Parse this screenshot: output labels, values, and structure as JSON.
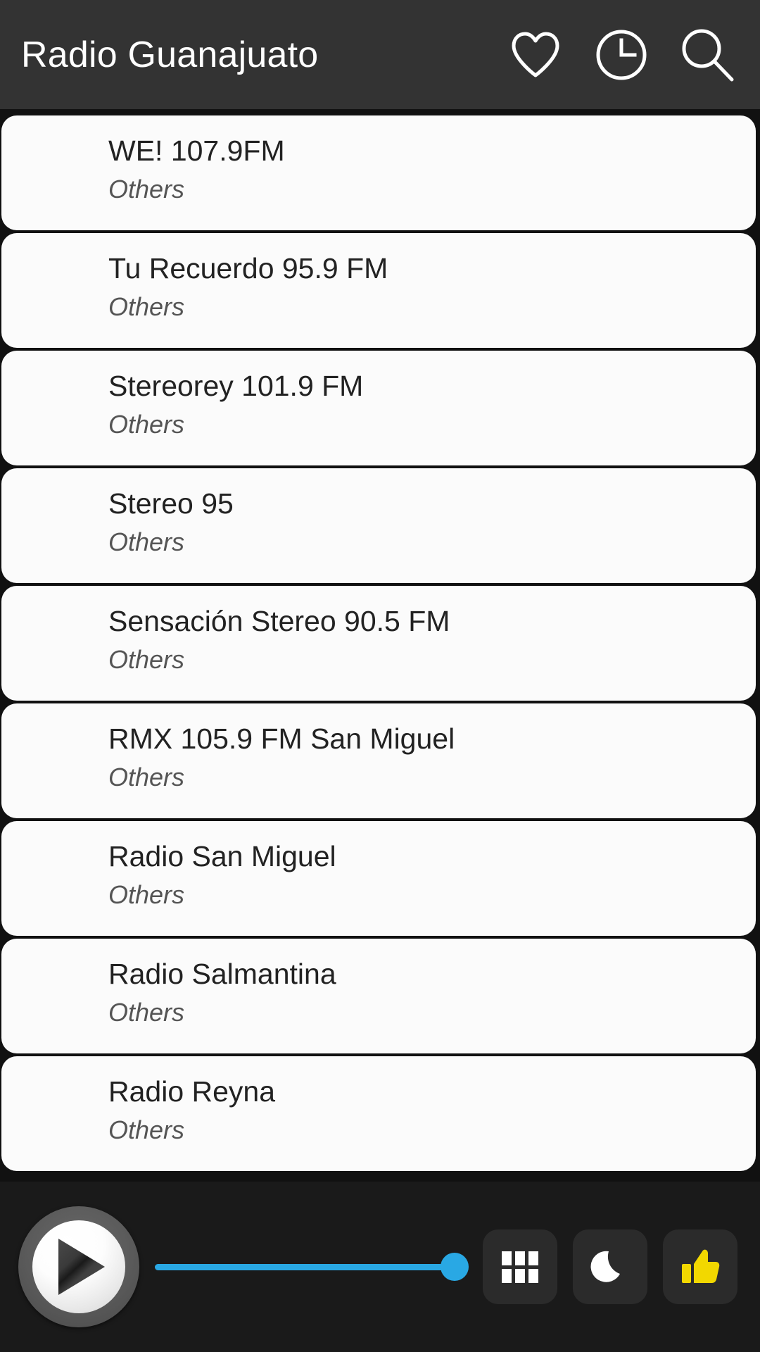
{
  "header": {
    "title": "Radio Guanajuato",
    "background_color": "#333333",
    "actions": [
      {
        "name": "favorites-icon",
        "icon": "heart-icon"
      },
      {
        "name": "history-icon",
        "icon": "clock-icon"
      },
      {
        "name": "search-icon",
        "icon": "search-icon"
      }
    ]
  },
  "stations": [
    {
      "name": "WE! 107.9FM",
      "genre": "Others"
    },
    {
      "name": "Tu Recuerdo 95.9 FM",
      "genre": "Others"
    },
    {
      "name": "Stereorey 101.9 FM",
      "genre": "Others"
    },
    {
      "name": "Stereo 95",
      "genre": "Others"
    },
    {
      "name": "Sensación Stereo 90.5 FM",
      "genre": "Others"
    },
    {
      "name": "RMX 105.9 FM San Miguel",
      "genre": "Others"
    },
    {
      "name": "Radio San Miguel",
      "genre": "Others"
    },
    {
      "name": "Radio Salmantina",
      "genre": "Others"
    },
    {
      "name": "Radio Reyna",
      "genre": "Others"
    }
  ],
  "player": {
    "play_button": "play-icon",
    "volume": {
      "value": 100,
      "accent_color": "#29a8e4"
    },
    "buttons": [
      {
        "name": "stations-grid-button",
        "icon": "grid-icon"
      },
      {
        "name": "sleep-timer-button",
        "icon": "moon-icon"
      },
      {
        "name": "like-button",
        "icon": "thumbs-up-icon",
        "color": "#f2d800"
      }
    ],
    "background_color": "#1a1a1a"
  }
}
